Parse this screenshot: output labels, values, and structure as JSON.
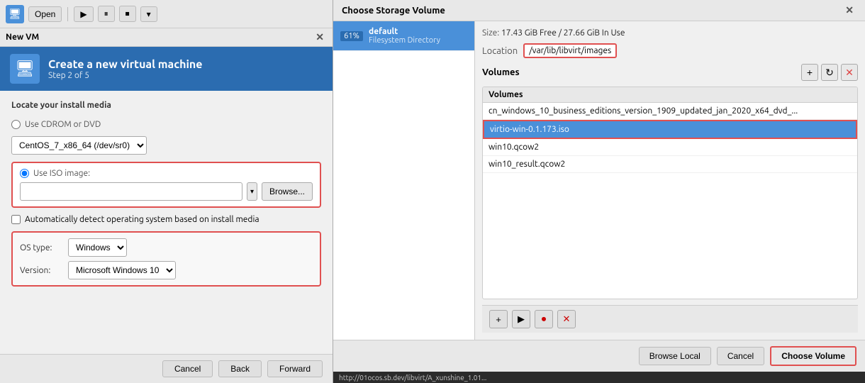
{
  "left": {
    "toolbar": {
      "icon_label": "🖥",
      "open_label": "Open",
      "play_icon": "▶",
      "pause_icon": "⏸",
      "stop_icon": "⏹",
      "menu_icon": "▾"
    },
    "window_title": "New VM",
    "wizard": {
      "title": "Create a new virtual machine",
      "step": "Step 2 of 5",
      "icon": "🖥"
    },
    "locate_label": "Locate your install media",
    "cdrom_label": "Use CDROM or DVD",
    "cdrom_dropdown": "CentOS_7_x86_64 (/dev/sr0)",
    "iso_label": "Use ISO image:",
    "iso_placeholder": "",
    "browse_label": "Browse...",
    "auto_detect_label": "Automatically detect operating system based on install media",
    "os_type_label": "OS type:",
    "os_type_value": "Windows",
    "version_label": "Version:",
    "version_value": "Microsoft Windows 10",
    "cancel_label": "Cancel",
    "back_label": "Back",
    "forward_label": "Forward"
  },
  "right": {
    "title": "Choose Storage Volume",
    "pool": {
      "percent": "61%",
      "name": "default",
      "type": "Filesystem Directory"
    },
    "size_label": "Size:",
    "size_value": "17.43 GiB Free / 27.66 GiB In Use",
    "location_label": "Location",
    "location_value": "/var/lib/libvirt/images",
    "volumes_label": "Volumes",
    "add_icon": "+",
    "refresh_icon": "↻",
    "delete_icon": "✕",
    "volumes": [
      {
        "name": "cn_windows_10_business_editions_version_1909_updated_jan_2020_x64_dvd_...",
        "selected": false
      },
      {
        "name": "virtio-win-0.1.173.iso",
        "selected": true
      },
      {
        "name": "win10.qcow2",
        "selected": false
      },
      {
        "name": "win10_result.qcow2",
        "selected": false
      }
    ],
    "bottom_toolbar": {
      "add": "+",
      "play": "▶",
      "record": "⏺",
      "stop": "✕"
    },
    "browse_local_label": "Browse Local",
    "cancel_label": "Cancel",
    "choose_label": "Choose Volume",
    "status_bar": "http://01ocos.sb.dev/libvirt/A_xunshine_1.01..."
  }
}
